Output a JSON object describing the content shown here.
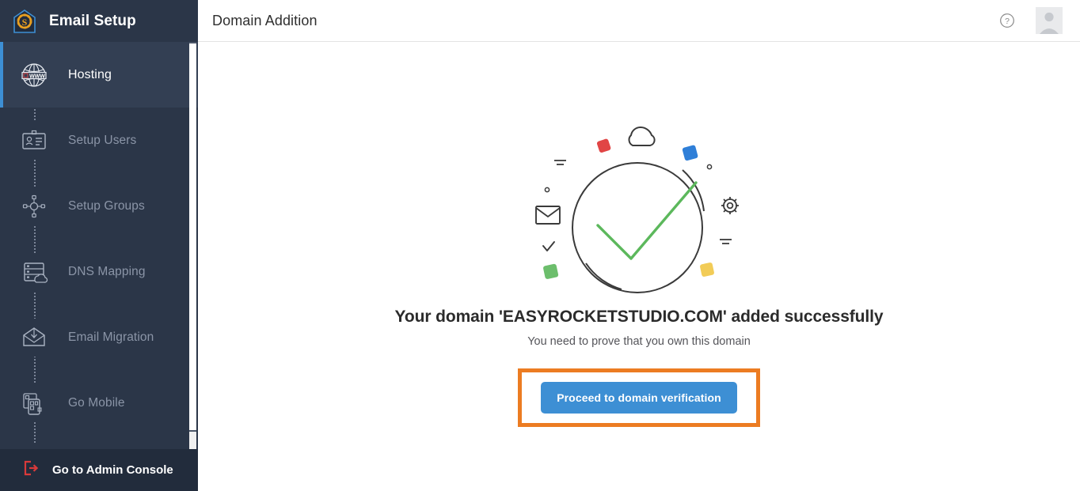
{
  "brand": {
    "title": "Email Setup",
    "logo_icon": "shield-gear-icon"
  },
  "sidebar": {
    "items": [
      {
        "label": "Hosting",
        "icon": "globe-www-icon",
        "active": true
      },
      {
        "label": "Setup Users",
        "icon": "id-card-icon",
        "active": false
      },
      {
        "label": "Setup Groups",
        "icon": "user-group-icon",
        "active": false
      },
      {
        "label": "DNS Mapping",
        "icon": "server-cloud-icon",
        "active": false
      },
      {
        "label": "Email Migration",
        "icon": "envelope-arrow-icon",
        "active": false
      },
      {
        "label": "Go Mobile",
        "icon": "mobile-qr-icon",
        "active": false
      }
    ],
    "admin_console": {
      "label": "Go to Admin Console",
      "icon": "exit-arrow-icon"
    }
  },
  "header": {
    "title": "Domain Addition",
    "help_icon": "question-circle-icon",
    "avatar_icon": "user-avatar-icon"
  },
  "main": {
    "illustration": "domain-verified-check-icon",
    "headline": "Your domain 'EASYROCKETSTUDIO.COM' added successfully",
    "subtext": "You need to prove that you own this domain",
    "cta_label": "Proceed to domain verification"
  },
  "colors": {
    "sidebar_bg": "#2b3648",
    "sidebar_active_bg": "#333f53",
    "accent_blue": "#3d8fd4",
    "highlight_orange": "#ec7c22",
    "admin_bg": "#222c3c",
    "logo_gold": "#e8a020",
    "exit_red": "#d93a3a",
    "check_green": "#5cb85c",
    "square_red": "#e14545",
    "square_blue": "#2f7fd8",
    "square_green": "#6cbe6c",
    "square_yellow": "#f2cc57"
  }
}
